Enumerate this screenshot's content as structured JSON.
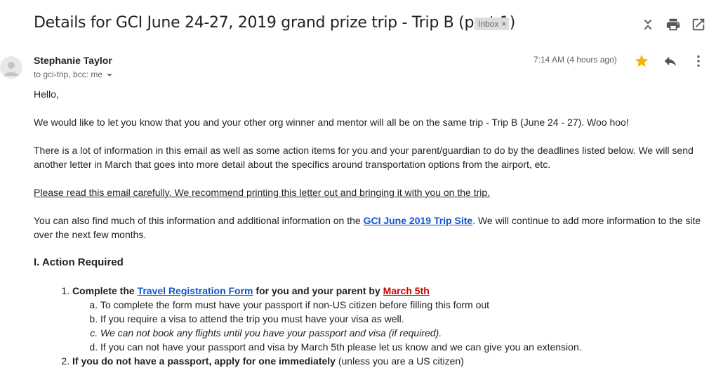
{
  "subject": "Details for GCI June 24-27, 2019 grand prize trip - Trip B (part 1)",
  "label": "Inbox",
  "label_remove": "×",
  "toolbar_icons": [
    "expand-collapse-icon",
    "print-icon",
    "open-in-new-window-icon"
  ],
  "sender": {
    "name": "Stephanie Taylor",
    "recipients": "to gci-trip, bcc: me",
    "timestamp": "7:14 AM (4 hours ago)"
  },
  "header_icons": [
    "star-icon",
    "reply-icon",
    "more-vert-icon"
  ],
  "colors": {
    "star": "#f4b400",
    "link": "#1155cc",
    "deadline": "#cc0000"
  },
  "body": {
    "greeting": "Hello,",
    "p1": "We would like to let you know that you and your other org winner and mentor will all be on the same trip - Trip B (June 24 - 27). Woo hoo!",
    "p2": "There is a lot of information in this email as well as some action items for you and your parent/guardian to do by the deadlines listed below. We will send another letter in March that goes into more detail about the specifics around transportation options from the airport, etc.",
    "p3": "Please read this email carefully. We recommend printing this letter out and bringing it with you on the trip.",
    "p4_before": "You can also find much of this information and additional information on the ",
    "p4_link": "GCI June 2019 Trip Site",
    "p4_after": ". We will continue to add more information to the site over the next few months.",
    "section_title": "I. Action Required",
    "item1": {
      "t1": "Complete the ",
      "link": "Travel Registration Form",
      "t2": " for you and your parent by ",
      "deadline": "March 5th",
      "subs": [
        "To complete the form must have your passport if non-US citizen before filling this form out",
        "If you require a visa to attend the trip you must have your visa as well.",
        "We can not book any flights until you have your passport and visa (if required).",
        "If you can not have your passport and visa by March 5th please let us know and we can give you an extension."
      ]
    },
    "item2": {
      "bold": "If you do not have a passport, apply for one immediately",
      "rest": " (unless you are a US citizen)"
    }
  }
}
